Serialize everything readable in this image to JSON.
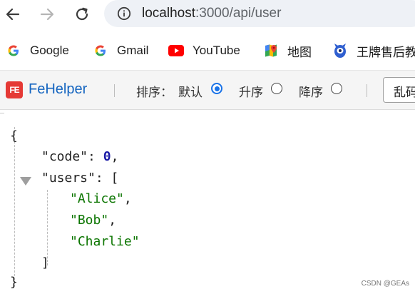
{
  "browser": {
    "url_host": "localhost",
    "url_rest": ":3000/api/user"
  },
  "bookmarks": [
    {
      "label": "Google",
      "icon": "google-icon"
    },
    {
      "label": "Gmail",
      "icon": "google-icon"
    },
    {
      "label": "YouTube",
      "icon": "youtube-icon"
    },
    {
      "label": "地图",
      "icon": "maps-icon"
    },
    {
      "label": "王牌售后教",
      "icon": "mascot-icon"
    }
  ],
  "fehelper": {
    "logo": "FE",
    "title": "FeHelper",
    "sort_label": "排序：",
    "sort_options": [
      {
        "label": "默认",
        "checked": true
      },
      {
        "label": "升序",
        "checked": false
      },
      {
        "label": "降序",
        "checked": false
      }
    ],
    "button_label": "乱码"
  },
  "json_view": {
    "open_brace": "{",
    "key_code": "\"code\"",
    "colon1": ":",
    "value_code": "0",
    "comma1": ",",
    "key_users": "\"users\"",
    "colon2": ":",
    "open_bracket": "[",
    "users": [
      "\"Alice\"",
      "\"Bob\"",
      "\"Charlie\""
    ],
    "comma": ",",
    "close_bracket": "]",
    "close_brace": "}"
  },
  "watermark": "CSDN @GEAs"
}
